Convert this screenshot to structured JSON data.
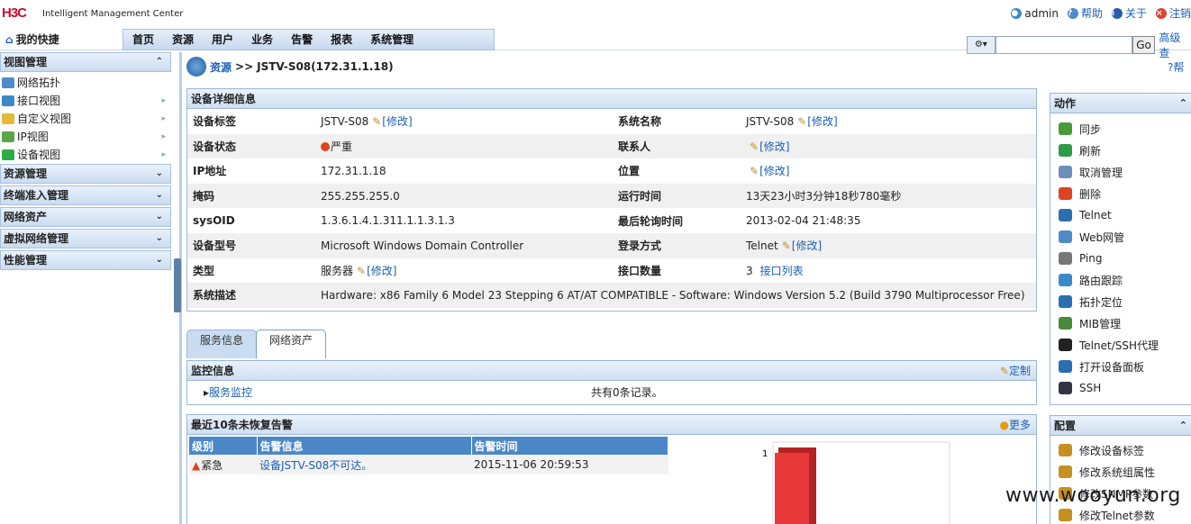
{
  "header": {
    "logo": "H3C",
    "product": "Intelligent Management Center",
    "user": "admin",
    "help": "帮助",
    "about": "关于",
    "logout": "注销"
  },
  "nav": {
    "quick": "我的快捷",
    "tabs": [
      "首页",
      "资源",
      "用户",
      "业务",
      "告警",
      "报表",
      "系统管理"
    ],
    "go": "Go",
    "advanced": "高级查"
  },
  "sidebar": {
    "view_mgmt": "视图管理",
    "view_items": [
      "网络拓扑",
      "接口视图",
      "自定义视图",
      "IP视图",
      "设备视图"
    ],
    "sections": [
      "资源管理",
      "终端准入管理",
      "网络资产",
      "虚拟网络管理",
      "性能管理"
    ]
  },
  "breadcrumb": {
    "root": "资源",
    "sep": ">>",
    "current": "JSTV-S08(172.31.1.18)"
  },
  "help_right": "帮",
  "detail": {
    "title": "设备详细信息",
    "edit": "[修改]",
    "rows": [
      {
        "l1": "设备标签",
        "v1": "JSTV-S08",
        "e1": true,
        "l2": "系统名称",
        "v2": "JSTV-S08",
        "e2": true
      },
      {
        "l1": "设备状态",
        "v1": "严重",
        "l2": "联系人",
        "v2": "",
        "e2": true
      },
      {
        "l1": "IP地址",
        "v1": "172.31.1.18",
        "l2": "位置",
        "v2": "",
        "e2": true
      },
      {
        "l1": "掩码",
        "v1": "255.255.255.0",
        "l2": "运行时间",
        "v2": "13天23小时3分钟18秒780毫秒"
      },
      {
        "l1": "sysOID",
        "v1": "1.3.6.1.4.1.311.1.1.3.1.3",
        "l2": "最后轮询时间",
        "v2": "2013-02-04 21:48:35"
      },
      {
        "l1": "设备型号",
        "v1": "Microsoft Windows Domain Controller",
        "l2": "登录方式",
        "v2": "Telnet",
        "e2": true
      },
      {
        "l1": "类型",
        "v1": "服务器",
        "e1": true,
        "l2": "接口数量",
        "v2": "3",
        "link2": "接口列表"
      }
    ],
    "desc_label": "系统描述",
    "desc": "Hardware: x86 Family 6 Model 23 Stepping 6 AT/AT COMPATIBLE - Software: Windows Version 5.2 (Build 3790 Multiprocessor Free)"
  },
  "subtabs": [
    "服务信息",
    "网络资产"
  ],
  "monitor": {
    "title": "监控信息",
    "custom": "定制",
    "service": "服务监控",
    "count": "共有0条记录。"
  },
  "alarms": {
    "title": "最近10条未恢复告警",
    "more": "更多",
    "headers": [
      "级别",
      "告警信息",
      "告警时间"
    ],
    "rows": [
      {
        "level": "紧急",
        "info": "设备JSTV-S08不可达。",
        "time": "2015-11-06 20:59:53"
      }
    ]
  },
  "chart_data": {
    "type": "bar",
    "categories": [
      ""
    ],
    "values": [
      1
    ],
    "yticks": [
      "1"
    ],
    "color": "#e83a3a"
  },
  "actions": {
    "title": "动作",
    "items": [
      "同步",
      "刷新",
      "取消管理",
      "删除",
      "Telnet",
      "Web网管",
      "Ping",
      "路由跟踪",
      "拓扑定位",
      "MIB管理",
      "Telnet/SSH代理",
      "打开设备面板",
      "SSH"
    ],
    "colors": [
      "#4b9a3a",
      "#2d9b4a",
      "#6b8fb8",
      "#d42",
      "#2a6fb0",
      "#4f8bc9",
      "#777",
      "#3a8ac9",
      "#2a6fb0",
      "#4a8a3a",
      "#222",
      "#2a6fb0",
      "#334"
    ]
  },
  "config": {
    "title": "配置",
    "items": [
      "修改设备标签",
      "修改系统组属性",
      "修改SNMP参数",
      "修改Telnet参数"
    ]
  },
  "watermark": "www.wooyun.org"
}
